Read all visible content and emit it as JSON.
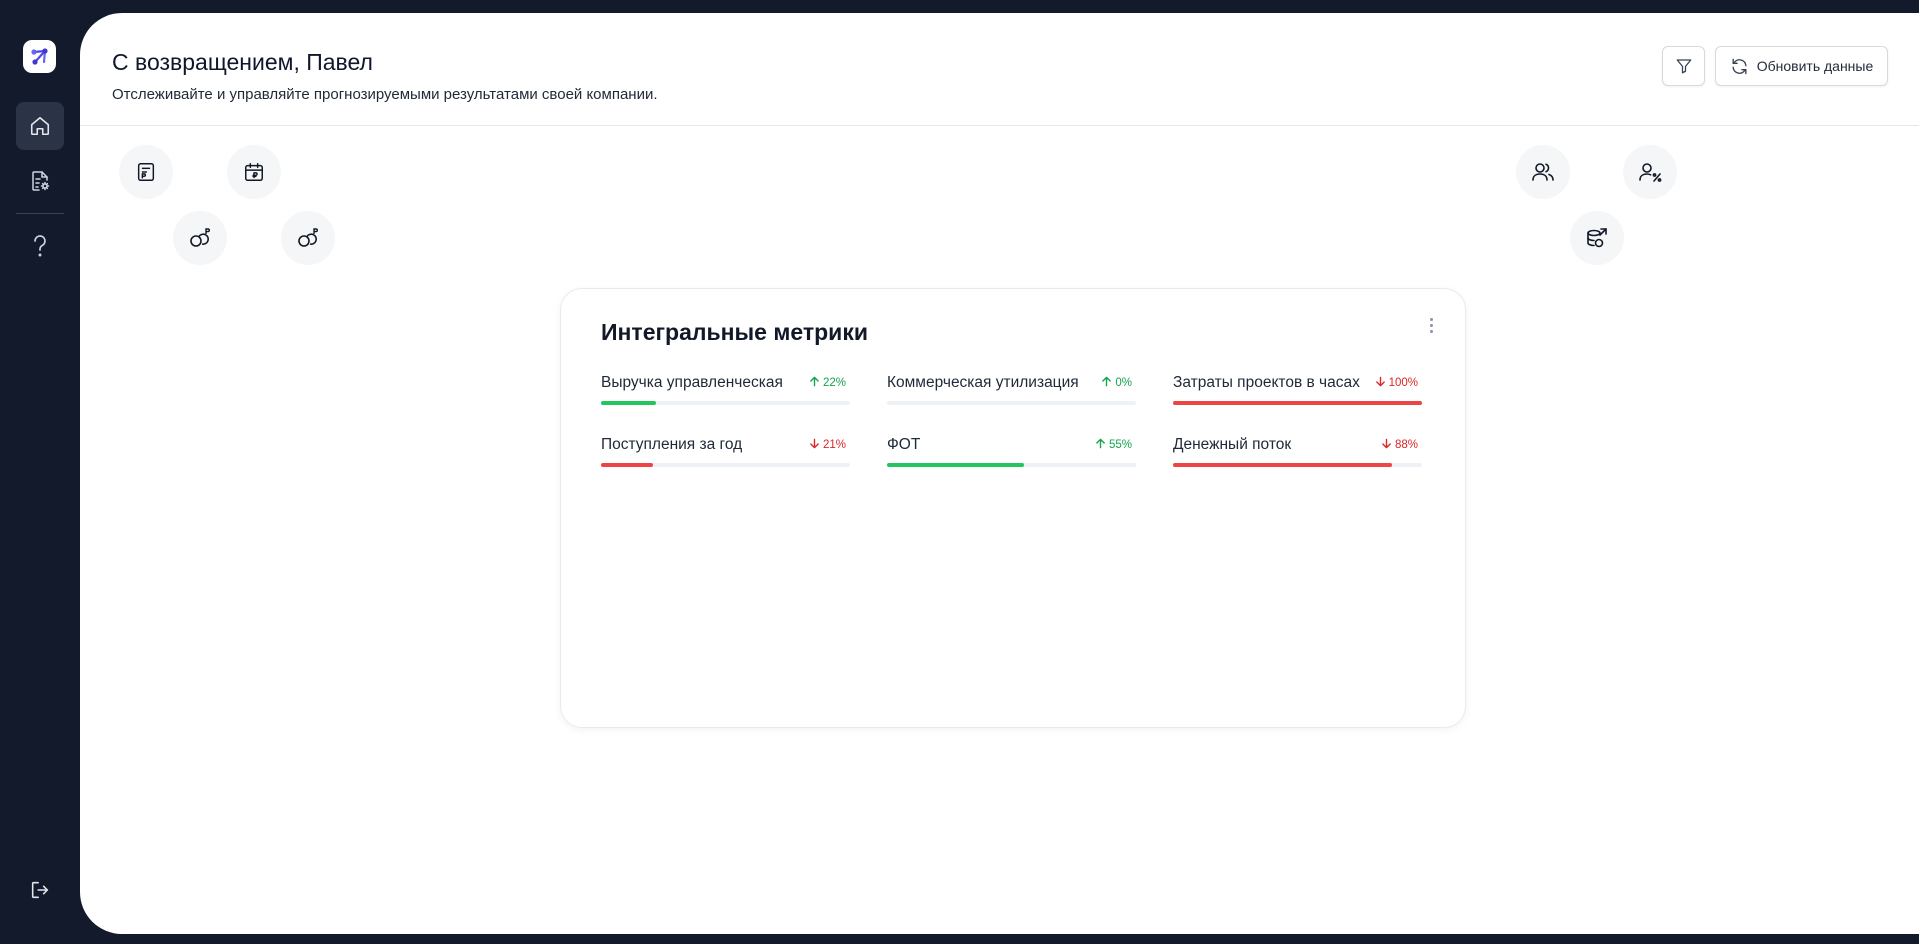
{
  "header": {
    "title": "С возвращением, Павел",
    "subtitle": "Отслеживайте и управляйте прогнозируемыми результатами своей компании.",
    "refresh_label": "Обновить данные"
  },
  "sidebar": {
    "items": [
      {
        "name": "home",
        "icon": "home-icon",
        "active": true
      },
      {
        "name": "reports",
        "icon": "report-settings-icon",
        "active": false
      },
      {
        "name": "help",
        "icon": "question-icon",
        "active": false
      }
    ],
    "logout_icon": "logout-icon"
  },
  "bubbles": [
    {
      "icon": "document-icon"
    },
    {
      "icon": "calendar-ruble-icon"
    },
    {
      "icon": "coins-ruble-icon"
    },
    {
      "icon": "coins-ruble-icon"
    },
    {
      "icon": "users-icon"
    },
    {
      "icon": "user-percent-icon"
    },
    {
      "icon": "database-arrow-icon"
    }
  ],
  "card": {
    "title": "Интегральные метрики",
    "metrics": [
      {
        "label": "Выручка управленческая",
        "change": "22%",
        "direction": "up",
        "level": 0.22,
        "color": "#22c55e"
      },
      {
        "label": "Коммерческая утилизация",
        "change": "0%",
        "direction": "up",
        "level": 0,
        "color": "#22c55e"
      },
      {
        "label": "Затраты проектов в часах",
        "change": "100%",
        "direction": "down",
        "level": 1.0,
        "color": "#ef4444"
      },
      {
        "label": "Поступления за год",
        "change": "21%",
        "direction": "down",
        "level": 0.21,
        "color": "#ef4444"
      },
      {
        "label": "ФОТ",
        "change": "55%",
        "direction": "up",
        "level": 0.55,
        "color": "#22c55e"
      },
      {
        "label": "Денежный поток",
        "change": "88%",
        "direction": "down",
        "level": 0.88,
        "color": "#ef4444"
      }
    ]
  },
  "colors": {
    "sidebar_bg": "#121a2b",
    "accent": "#4f46e5",
    "up": "#16a34a",
    "down": "#dc2626"
  }
}
